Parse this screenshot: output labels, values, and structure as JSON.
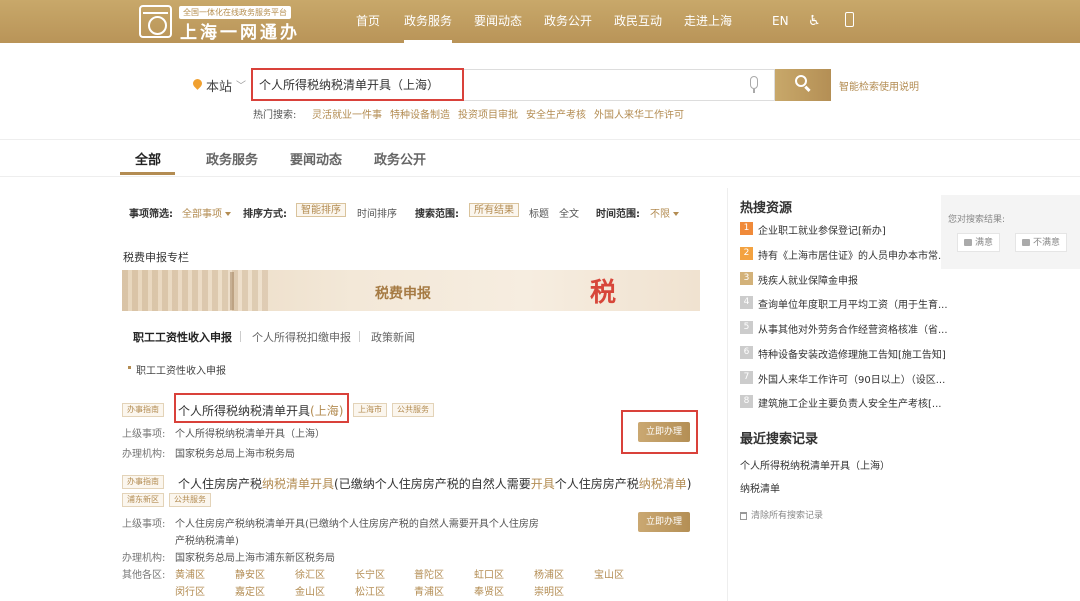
{
  "header": {
    "logo_tag": "全国一体化在线政务服务平台",
    "logo_title": "上海一网通办",
    "nav": [
      "首页",
      "政务服务",
      "要闻动态",
      "政务公开",
      "政民互动",
      "走进上海"
    ],
    "lang": "EN",
    "accessibility_icon": "accessibility-icon",
    "mobile_icon": "mobile-icon"
  },
  "search": {
    "scope": "本站",
    "value": "个人所得税纳税清单开具（上海）",
    "help": "智能检索使用说明",
    "hot_label": "热门搜索:",
    "hot": [
      "灵活就业一件事",
      "特种设备制造",
      "投资项目审批",
      "安全生产考核",
      "外国人来华工作许可"
    ]
  },
  "tabs": [
    "全部",
    "政务服务",
    "要闻动态",
    "政务公开"
  ],
  "filters": {
    "item_label": "事项筛选:",
    "item_value": "全部事项",
    "sort_label": "排序方式:",
    "sort_options": [
      "智能排序",
      "时间排序"
    ],
    "scope_label": "搜索范围:",
    "scope_options": [
      "所有结果",
      "标题",
      "全文"
    ],
    "time_label": "时间范围:",
    "time_value": "不限"
  },
  "tax_section": {
    "title": "税费申报专栏",
    "banner_text": "税费申报",
    "banner_seal": "税",
    "subtabs": [
      "职工工资性收入申报",
      "个人所得税扣缴申报",
      "政策新闻"
    ],
    "bullet": "职工工资性收入申报"
  },
  "results": [
    {
      "tag": "办事指南",
      "title_plain": "个人所得税纳税清单开具",
      "title_hl": "(上海)",
      "chips": [
        "上海市",
        "公共服务"
      ],
      "parent_label": "上级事项:",
      "parent_value": "个人所得税纳税清单开具（上海）",
      "org_label": "办理机构:",
      "org_value": "国家税务总局上海市税务局",
      "button": "立即办理"
    },
    {
      "tag": "办事指南",
      "title_a": "个人住房房产税",
      "title_b": "纳税清单开具",
      "title_c": "(已缴纳个人住房房产税的自然人需要",
      "title_d": "开具",
      "title_e": "个人住房房产税",
      "title_f": "纳税清单",
      "title_g": ")",
      "chips": [
        "浦东新区",
        "公共服务"
      ],
      "parent_label": "上级事项:",
      "parent_value_1": "个人住房房产税纳税清单开具(已缴纳个人住房房产税的自然人需要开具个人住房房",
      "parent_value_2": "产税纳税清单)",
      "org_label": "办理机构:",
      "org_value": "国家税务总局上海市浦东新区税务局",
      "districts_label": "其他各区:",
      "districts": [
        "黄浦区",
        "静安区",
        "徐汇区",
        "长宁区",
        "普陀区",
        "虹口区",
        "杨浦区",
        "宝山区",
        "闵行区",
        "嘉定区",
        "金山区",
        "松江区",
        "青浦区",
        "奉贤区",
        "崇明区"
      ],
      "button": "立即办理"
    }
  ],
  "sidebar": {
    "hot_title": "热搜资源",
    "hot_items": [
      "企业职工就业参保登记[新办]",
      "持有《上海市居住证》的人员申办本市常...",
      "残疾人就业保障金申报",
      "查询单位年度职工月平均工资（用于生育...",
      "从事其他对外劳务合作经营资格核准（省...",
      "特种设备安装改造修理施工告知[施工告知]",
      "外国人来华工作许可（90日以上）（设区...",
      "建筑施工企业主要负责人安全生产考核[..."
    ],
    "recent_title": "最近搜索记录",
    "recent_items": [
      "个人所得税纳税清单开具（上海）",
      "纳税清单"
    ],
    "clear": "清除所有搜索记录"
  },
  "feedback": {
    "question": "您对搜索结果:",
    "satisfied": "满意",
    "unsatisfied": "不满意"
  }
}
